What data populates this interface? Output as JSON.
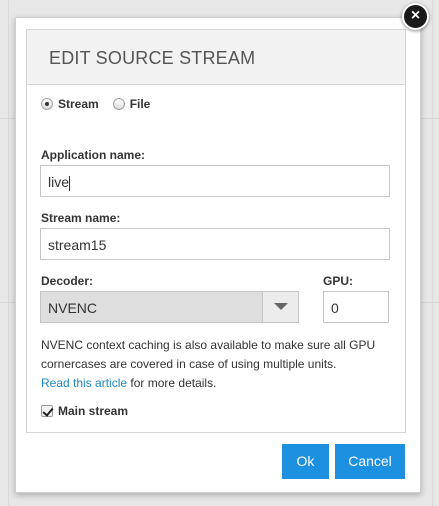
{
  "dialog": {
    "title": "EDIT SOURCE STREAM",
    "close_symbol": "×"
  },
  "source_type": {
    "options": [
      {
        "label": "Stream",
        "selected": true
      },
      {
        "label": "File",
        "selected": false
      }
    ]
  },
  "fields": {
    "application_name": {
      "label": "Application name:",
      "value": "live"
    },
    "stream_name": {
      "label": "Stream name:",
      "value": "stream15"
    },
    "decoder": {
      "label": "Decoder:",
      "value": "NVENC"
    },
    "gpu": {
      "label": "GPU:",
      "value": "0"
    }
  },
  "help": {
    "text": "NVENC context caching is also available to make sure all GPU cornercases are covered in case of using multiple units.",
    "link_text": "Read this article",
    "suffix": " for more details."
  },
  "main_stream": {
    "label": "Main stream",
    "checked": true
  },
  "buttons": {
    "ok": "Ok",
    "cancel": "Cancel"
  },
  "colors": {
    "accent": "#1e90e0",
    "link": "#1e88c7"
  }
}
